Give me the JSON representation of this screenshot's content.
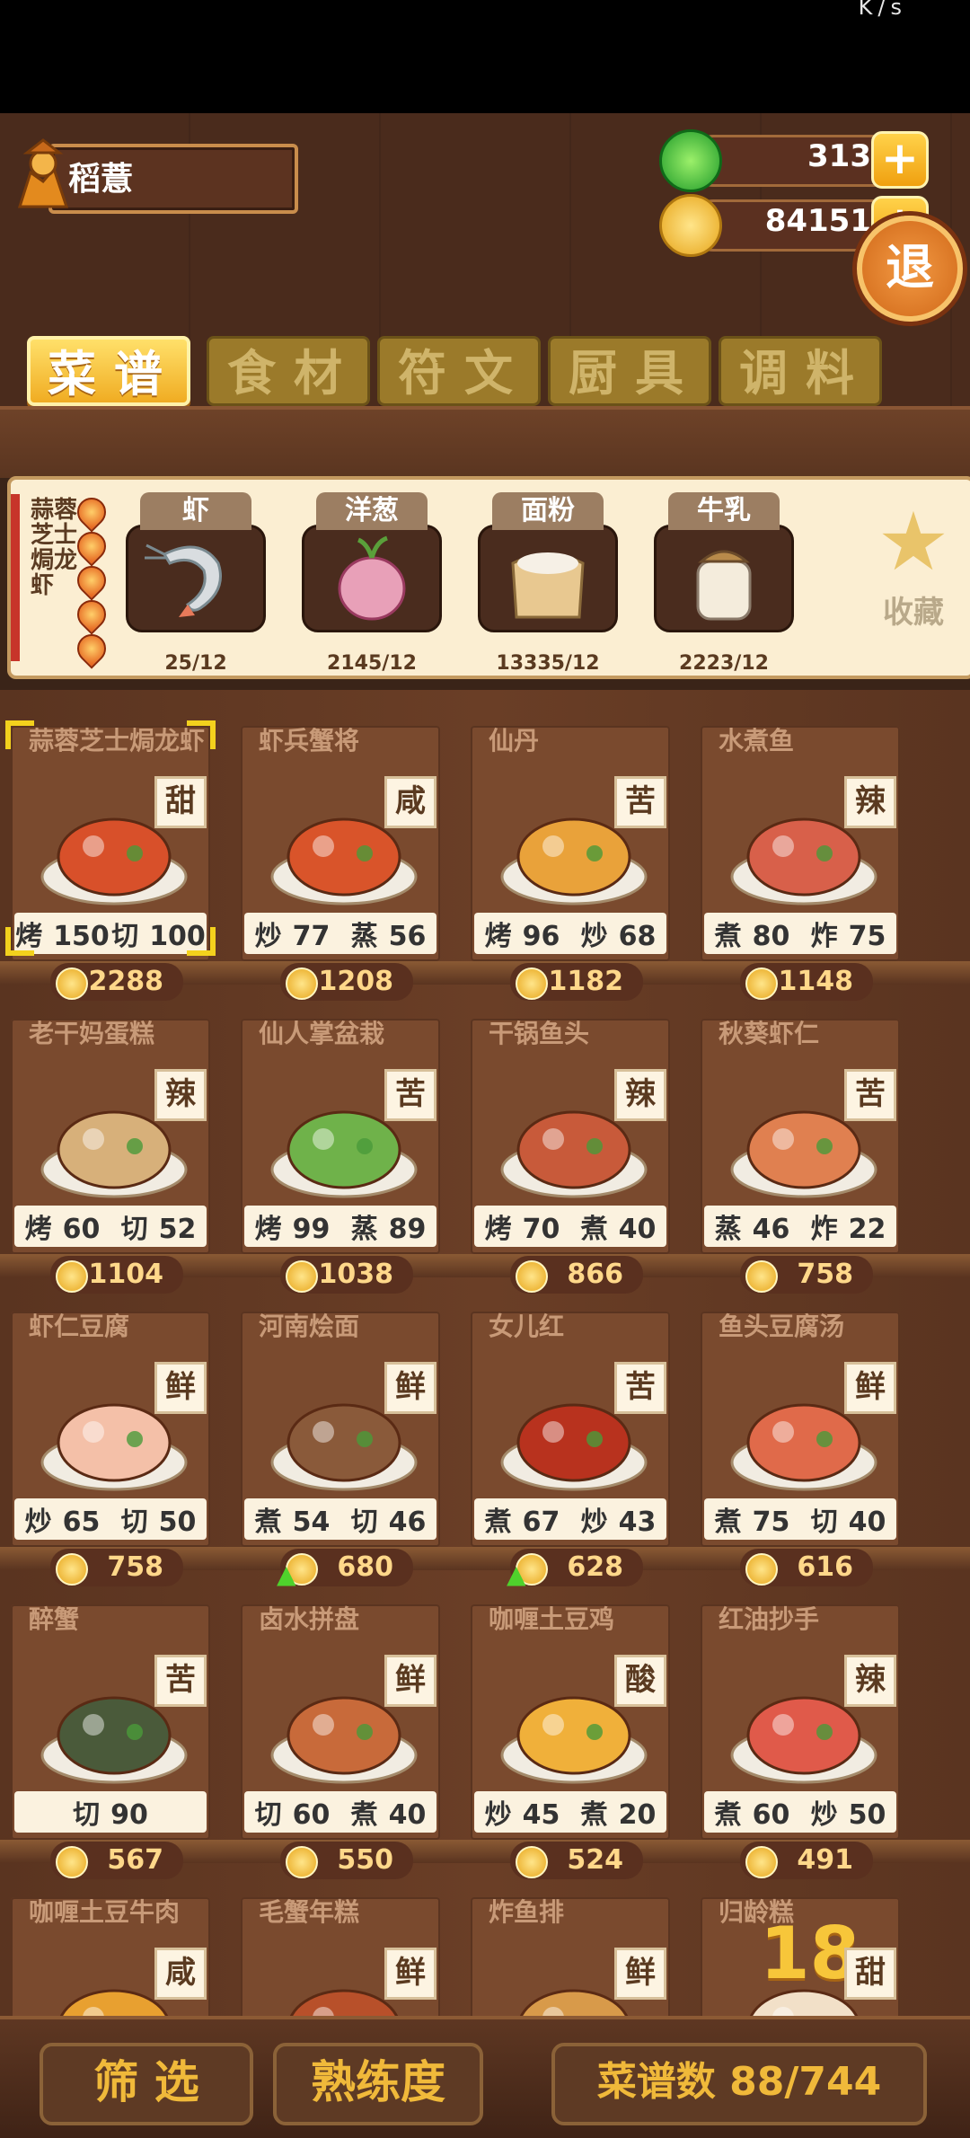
{
  "statusbar": {
    "text": "K/s"
  },
  "player": {
    "name": "稻薏"
  },
  "currency": {
    "jade": {
      "value": "313",
      "plus": "+"
    },
    "coins": {
      "value": "84151",
      "plus": "+"
    }
  },
  "exit_label": "退",
  "tabs": [
    {
      "label": "菜谱",
      "active": true
    },
    {
      "label": "食材",
      "active": false
    },
    {
      "label": "符文",
      "active": false
    },
    {
      "label": "厨具",
      "active": false
    },
    {
      "label": "调料",
      "active": false
    }
  ],
  "selected_recipe": {
    "name": "蒜蓉芝士焗龙虾",
    "ingredients": [
      {
        "name": "虾",
        "qty": "25/12",
        "icon": "shrimp-icon"
      },
      {
        "name": "洋葱",
        "qty": "2145/12",
        "icon": "onion-icon"
      },
      {
        "name": "面粉",
        "qty": "13335/12",
        "icon": "flour-icon"
      },
      {
        "name": "牛乳",
        "qty": "2223/12",
        "icon": "milk-icon"
      }
    ],
    "favorite_label": "收藏"
  },
  "recipes": [
    {
      "name": "蒜蓉芝士焗龙虾",
      "taste": "甜",
      "skills": [
        [
          "烤",
          "150"
        ],
        [
          "切",
          "100"
        ]
      ],
      "price": "2288",
      "up": false,
      "selected": true,
      "dish_color": "#d8502a"
    },
    {
      "name": "虾兵蟹将",
      "taste": "咸",
      "skills": [
        [
          "炒",
          "77"
        ],
        [
          "蒸",
          "56"
        ]
      ],
      "price": "1208",
      "up": false,
      "dish_color": "#d9542a"
    },
    {
      "name": "仙丹",
      "taste": "苦",
      "skills": [
        [
          "烤",
          "96"
        ],
        [
          "炒",
          "68"
        ]
      ],
      "price": "1182",
      "up": false,
      "dish_color": "#e9a23a"
    },
    {
      "name": "水煮鱼",
      "taste": "辣",
      "skills": [
        [
          "煮",
          "80"
        ],
        [
          "炸",
          "75"
        ]
      ],
      "price": "1148",
      "up": false,
      "dish_color": "#d8604a"
    },
    {
      "name": "老干妈蛋糕",
      "taste": "辣",
      "skills": [
        [
          "烤",
          "60"
        ],
        [
          "切",
          "52"
        ]
      ],
      "price": "1104",
      "up": false,
      "dish_color": "#d7b07a"
    },
    {
      "name": "仙人掌盆栽",
      "taste": "苦",
      "skills": [
        [
          "烤",
          "99"
        ],
        [
          "蒸",
          "89"
        ]
      ],
      "price": "1038",
      "up": false,
      "dish_color": "#6fb24a"
    },
    {
      "name": "干锅鱼头",
      "taste": "辣",
      "skills": [
        [
          "烤",
          "70"
        ],
        [
          "煮",
          "40"
        ]
      ],
      "price": "866",
      "up": false,
      "dish_color": "#c85a3a"
    },
    {
      "name": "秋葵虾仁",
      "taste": "苦",
      "skills": [
        [
          "蒸",
          "46"
        ],
        [
          "炸",
          "22"
        ]
      ],
      "price": "758",
      "up": false,
      "dish_color": "#e08050"
    },
    {
      "name": "虾仁豆腐",
      "taste": "鲜",
      "skills": [
        [
          "炒",
          "65"
        ],
        [
          "切",
          "50"
        ]
      ],
      "price": "758",
      "up": false,
      "dish_color": "#f4c0a8"
    },
    {
      "name": "河南烩面",
      "taste": "鲜",
      "skills": [
        [
          "煮",
          "54"
        ],
        [
          "切",
          "46"
        ]
      ],
      "price": "680",
      "up": true,
      "dish_color": "#8a5a3a"
    },
    {
      "name": "女儿红",
      "taste": "苦",
      "skills": [
        [
          "煮",
          "67"
        ],
        [
          "炒",
          "43"
        ]
      ],
      "price": "628",
      "up": true,
      "dish_color": "#b8321e"
    },
    {
      "name": "鱼头豆腐汤",
      "taste": "鲜",
      "skills": [
        [
          "煮",
          "75"
        ],
        [
          "切",
          "40"
        ]
      ],
      "price": "616",
      "up": false,
      "dish_color": "#e06a4a"
    },
    {
      "name": "醉蟹",
      "taste": "苦",
      "skills": [
        [
          "切",
          "90"
        ]
      ],
      "price": "567",
      "up": false,
      "dish_color": "#4a5a3a"
    },
    {
      "name": "卤水拼盘",
      "taste": "鲜",
      "skills": [
        [
          "切",
          "60"
        ],
        [
          "煮",
          "40"
        ]
      ],
      "price": "550",
      "up": false,
      "dish_color": "#c86a3a"
    },
    {
      "name": "咖喱土豆鸡",
      "taste": "酸",
      "skills": [
        [
          "炒",
          "45"
        ],
        [
          "煮",
          "20"
        ]
      ],
      "price": "524",
      "up": false,
      "dish_color": "#f0b03a"
    },
    {
      "name": "红油抄手",
      "taste": "辣",
      "skills": [
        [
          "煮",
          "60"
        ],
        [
          "炒",
          "50"
        ]
      ],
      "price": "491",
      "up": false,
      "dish_color": "#e05a4a"
    },
    {
      "name": "咖喱土豆牛肉",
      "taste": "咸",
      "skills": [],
      "price": "",
      "up": false,
      "dish_color": "#e8a030"
    },
    {
      "name": "毛蟹年糕",
      "taste": "鲜",
      "skills": [],
      "price": "",
      "up": false,
      "dish_color": "#b8502a"
    },
    {
      "name": "炸鱼排",
      "taste": "鲜",
      "skills": [],
      "price": "",
      "up": false,
      "dish_color": "#d89a4a"
    },
    {
      "name": "归龄糕",
      "taste": "甜",
      "skills": [],
      "price": "",
      "up": false,
      "dish_color": "#f2e0c8",
      "badge": "18"
    }
  ],
  "bottom": {
    "filter_label": "筛 选",
    "proficiency_label": "熟练度",
    "recipe_count_label": "菜谱数 88/744"
  }
}
